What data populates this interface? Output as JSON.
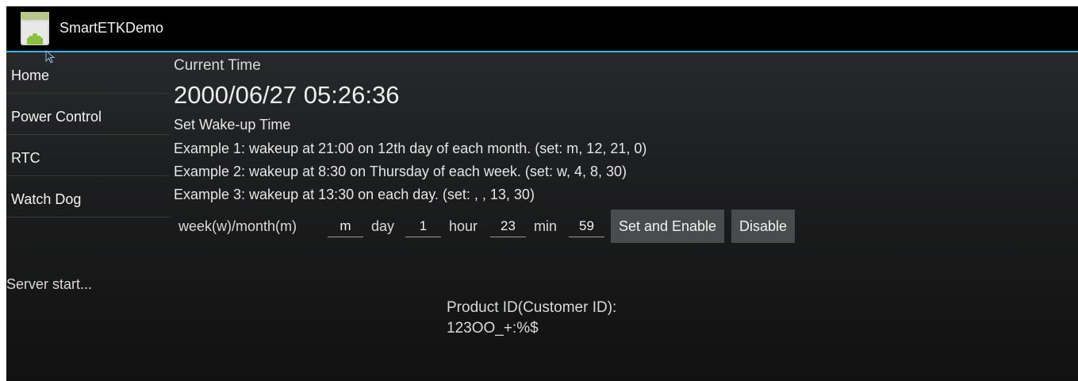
{
  "app": {
    "title": "SmartETKDemo"
  },
  "drawer": {
    "items": [
      {
        "label": "Home"
      },
      {
        "label": "Power Control"
      },
      {
        "label": "RTC"
      },
      {
        "label": "Watch Dog"
      }
    ]
  },
  "content": {
    "current_time_label": "Current Time",
    "current_time_value": "2000/06/27 05:26:36",
    "set_wakeup_label": "Set Wake-up Time",
    "examples": [
      "Example 1: wakeup at 21:00 on 12th day of each month. (set: m, 12, 21, 0)",
      "Example 2: wakeup at 8:30 on Thursday of each week. (set: w, 4, 8, 30)",
      "Example 3: wakeup at 13:30 on each day. (set: ,  , 13, 30)"
    ],
    "form": {
      "week_month_label": "week(w)/month(m)",
      "week_month_value": "m",
      "day_label": "day",
      "day_value": "1",
      "hour_label": "hour",
      "hour_value": "23",
      "min_label": "min",
      "min_value": "59",
      "set_enable_button": "Set and Enable",
      "disable_button": "Disable"
    }
  },
  "status": {
    "server_text": "Server start..."
  },
  "product": {
    "label": "Product ID(Customer ID):",
    "value": "123OO_+:%$"
  },
  "colors": {
    "accent": "#33b5e5",
    "button_bg": "#4a4b4c"
  }
}
